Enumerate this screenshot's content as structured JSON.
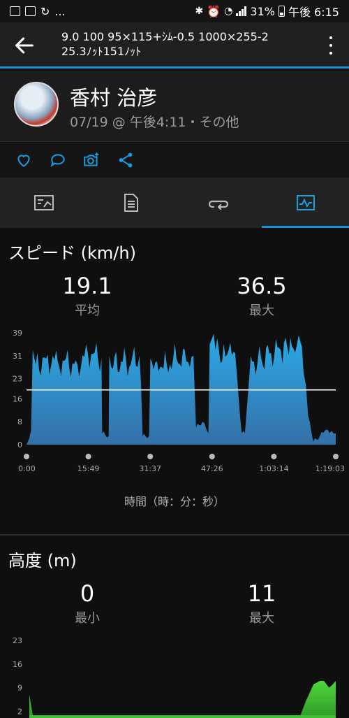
{
  "status_bar": {
    "left_text": "...",
    "battery": "31%",
    "time": "午後 6:15"
  },
  "app_bar": {
    "title_line1": "9.0 100 95×115+ｼﾑ-0.5 1000×255-2",
    "title_line2": "25.3ﾉｯﾄ151ﾉｯﾄ"
  },
  "profile": {
    "name": "香村 治彦",
    "meta": "07/19 @ 午後4:11・その他"
  },
  "speed": {
    "title": "スピード (km/h)",
    "avg_value": "19.1",
    "avg_label": "平均",
    "max_value": "36.5",
    "max_label": "最大",
    "x_axis_title": "時間（時：分：秒）"
  },
  "altitude": {
    "title": "高度 (m)",
    "min_value": "0",
    "min_label": "最小",
    "max_value": "11",
    "max_label": "最大"
  },
  "chart_data": [
    {
      "type": "area",
      "series_color": "#2aaae6",
      "y_ticks": [
        "0",
        "8",
        "16",
        "23",
        "31",
        "39"
      ],
      "ylim": [
        0,
        39
      ],
      "x_ticks": [
        "0:00",
        "15:49",
        "31:37",
        "47:26",
        "1:03:14",
        "1:19:03"
      ],
      "xlim_seconds": [
        0,
        4743
      ],
      "average_line": 19.1,
      "x": [
        0,
        40,
        70,
        95,
        140,
        300,
        480,
        780,
        940,
        1150,
        1160,
        1260,
        1270,
        1300,
        1450,
        1600,
        1730,
        1780,
        1880,
        1900,
        2000,
        2150,
        2300,
        2450,
        2560,
        2600,
        2700,
        2790,
        2810,
        2900,
        3000,
        3100,
        3200,
        3300,
        3350,
        3440,
        3460,
        3600,
        3750,
        3900,
        4000,
        4120,
        4200,
        4250,
        4320,
        4400,
        4500,
        4580,
        4650,
        4743
      ],
      "values": [
        0,
        2,
        5,
        33,
        28,
        30,
        29,
        28,
        32,
        30,
        4,
        3,
        31,
        27,
        29,
        28,
        31,
        3,
        3,
        30,
        29,
        28,
        30,
        29,
        31,
        6,
        8,
        4,
        35,
        33,
        29,
        33,
        32,
        4,
        4,
        31,
        29,
        30,
        32,
        33,
        34,
        32,
        36,
        25,
        10,
        1,
        3,
        5,
        4,
        4
      ]
    },
    {
      "type": "area",
      "series_color": "#4fd63c",
      "y_ticks": [
        "2",
        "9",
        "16",
        "23"
      ],
      "ylim": [
        0,
        23
      ],
      "x": [
        0,
        60,
        120,
        400,
        1200,
        2400,
        3600,
        4180,
        4280,
        4400,
        4500,
        4560,
        4640,
        4700,
        4743
      ],
      "values": [
        7,
        0,
        0,
        0,
        0,
        0,
        0,
        0,
        5,
        10,
        11,
        11,
        9,
        10,
        11
      ]
    }
  ]
}
